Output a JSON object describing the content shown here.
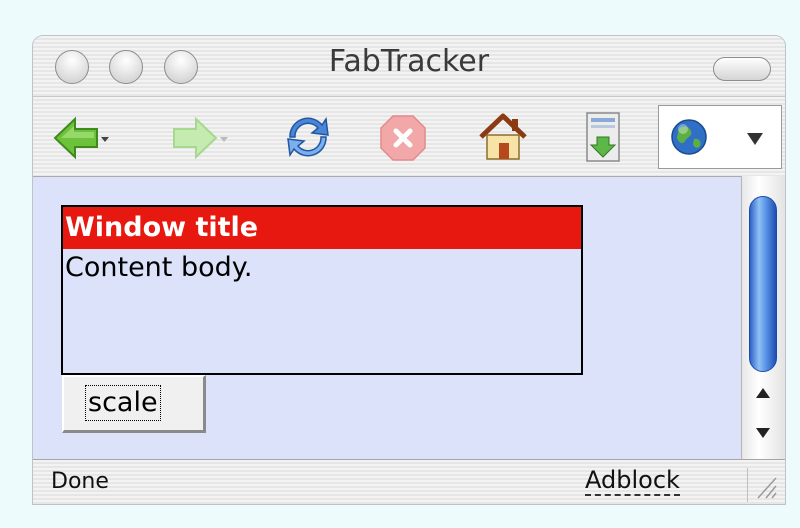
{
  "window": {
    "title": "FabTracker"
  },
  "toolbar": {
    "icons": [
      "back-arrow-icon",
      "forward-arrow-icon",
      "reload-icon",
      "stop-icon",
      "home-icon",
      "download-icon",
      "globe-icon"
    ]
  },
  "panel": {
    "title": "Window title",
    "body": "Content body."
  },
  "buttons": {
    "scale_label": "scale"
  },
  "status": {
    "left_text": "Done",
    "right_text": "Adblock"
  },
  "colors": {
    "panel_title_bg": "#e7180f",
    "content_bg": "#dde2fb",
    "page_bg": "#eefbfd"
  }
}
